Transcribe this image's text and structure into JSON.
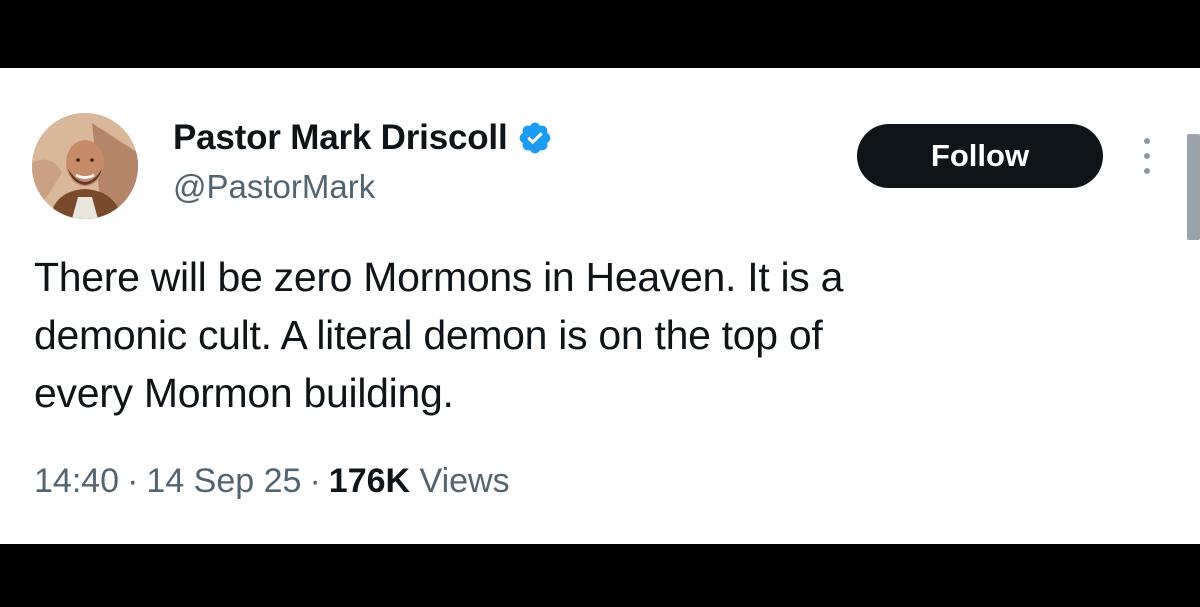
{
  "tweet": {
    "author": {
      "display_name": "Pastor Mark Driscoll",
      "handle": "@PastorMark",
      "verified_icon": "verified-badge-icon"
    },
    "follow_label": "Follow",
    "more_icon": "more-options-icon",
    "text": "There will be zero Mormons in Heaven. It is a\ndemonic cult. A literal demon is on the top of\nevery Mormon building.",
    "time": "14:40",
    "date": "14 Sep 25",
    "views_count": "176K",
    "views_label": "Views",
    "separator": "·"
  },
  "colors": {
    "text_primary": "#0f1419",
    "text_secondary": "#536471",
    "verified_blue": "#1d9bf0",
    "button_bg": "#0f1419",
    "letterbox": "#000000"
  }
}
